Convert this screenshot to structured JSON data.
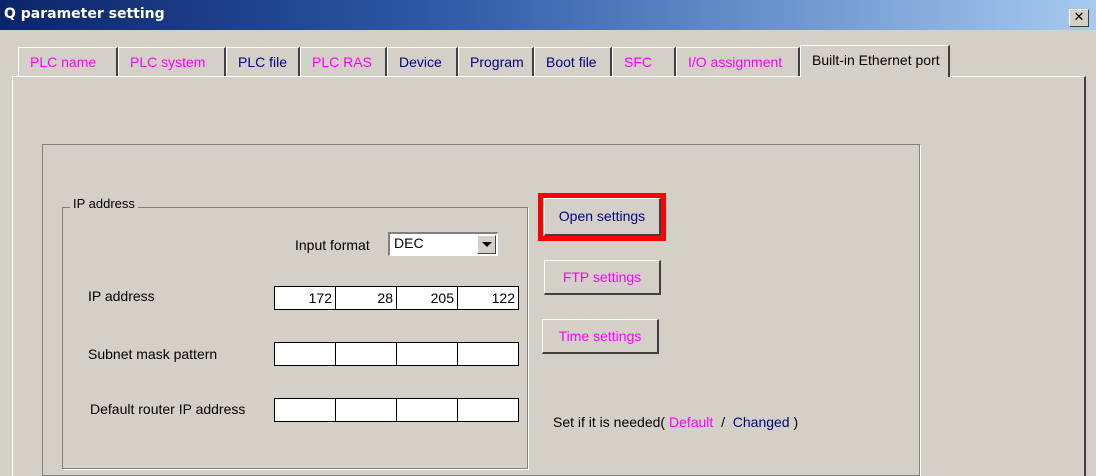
{
  "window": {
    "title": "Q parameter setting",
    "close_glyph": "✕"
  },
  "tabs": [
    {
      "label": "PLC name",
      "color": "#ff00ff"
    },
    {
      "label": "PLC system",
      "color": "#ff00ff"
    },
    {
      "label": "PLC file",
      "color": "#000080"
    },
    {
      "label": "PLC RAS",
      "color": "#ff00ff"
    },
    {
      "label": "Device",
      "color": "#000080"
    },
    {
      "label": "Program",
      "color": "#000080"
    },
    {
      "label": "Boot file",
      "color": "#000080"
    },
    {
      "label": "SFC",
      "color": "#ff00ff"
    },
    {
      "label": "I/O assignment",
      "color": "#ff00ff"
    },
    {
      "label": "Built-in Ethernet port",
      "color": "#000000",
      "active": true
    }
  ],
  "ip_group": {
    "title": "IP address",
    "input_format_label": "Input format",
    "input_format_value": "DEC",
    "ip_address_label": "IP address",
    "ip_address": [
      "172",
      "28",
      "205",
      "122"
    ],
    "subnet_label": "Subnet mask pattern",
    "subnet": [
      "",
      "",
      "",
      ""
    ],
    "router_label": "Default router IP address",
    "router": [
      "",
      "",
      "",
      ""
    ]
  },
  "buttons": {
    "open_settings": "Open settings",
    "ftp_settings": "FTP settings",
    "time_settings": "Time settings"
  },
  "legend": {
    "prefix": "Set if it is needed(",
    "default": "Default",
    "separator": "/",
    "changed": "Changed",
    "suffix": ")"
  },
  "colors": {
    "highlight": "#ff0000",
    "default_text": "#ff00ff",
    "changed_text": "#000080"
  }
}
